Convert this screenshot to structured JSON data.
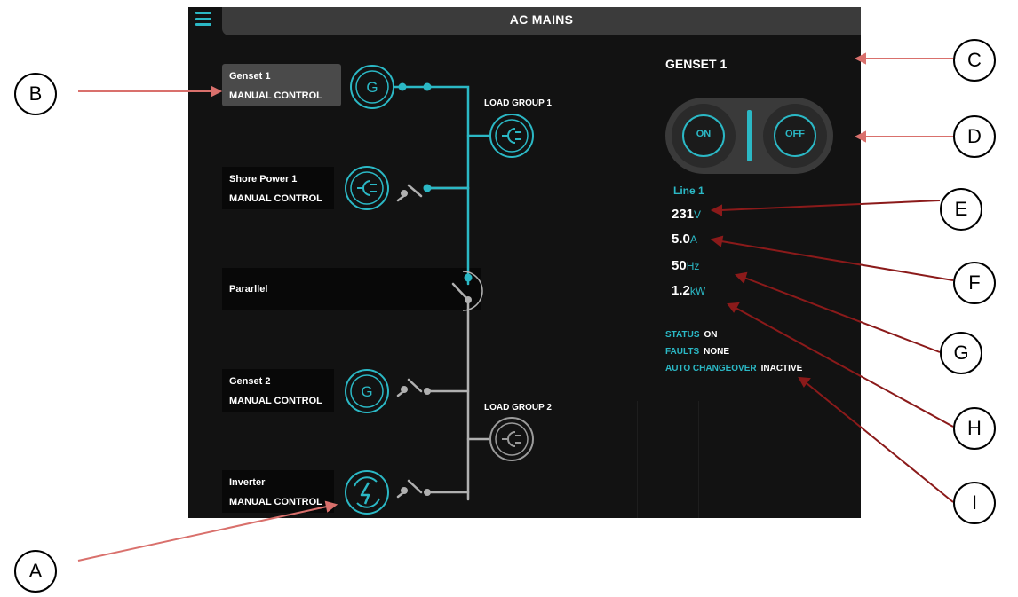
{
  "header": {
    "title": "AC MAINS",
    "menu_icon": "hamburger-menu-icon"
  },
  "sources": [
    {
      "id": "genset1",
      "name": "Genset 1",
      "mode": "MANUAL CONTROL",
      "icon": "generator-icon",
      "selected": true
    },
    {
      "id": "shore1",
      "name": "Shore Power 1",
      "mode": "MANUAL CONTROL",
      "icon": "shore-plug-icon"
    },
    {
      "id": "genset2",
      "name": "Genset 2",
      "mode": "MANUAL CONTROL",
      "icon": "generator-icon"
    },
    {
      "id": "inverter",
      "name": "Inverter",
      "mode": "MANUAL CONTROL",
      "icon": "inverter-icon"
    }
  ],
  "parallel": {
    "label": "Pararllel"
  },
  "load_groups": [
    {
      "label": "LOAD GROUP 1",
      "active": true
    },
    {
      "label": "LOAD GROUP 2",
      "active": false
    }
  ],
  "panel": {
    "title": "GENSET 1",
    "on_label": "ON",
    "off_label": "OFF",
    "line_title": "Line 1",
    "readings": [
      {
        "value": "231",
        "unit": "V"
      },
      {
        "value": "5.0",
        "unit": "A"
      },
      {
        "value": "50",
        "unit": "Hz"
      },
      {
        "value": "1.2",
        "unit": "kW"
      }
    ],
    "status_label": "STATUS",
    "status_value": "ON",
    "faults_label": "FAULTS",
    "faults_value": "NONE",
    "auto_label": "AUTO CHANGEOVER",
    "auto_value": "INACTIVE"
  },
  "callouts": [
    "A",
    "B",
    "C",
    "D",
    "E",
    "F",
    "G",
    "H",
    "I"
  ],
  "colors": {
    "accent": "#2bb8c5",
    "inactive": "#b0b0b0",
    "background": "#121212",
    "arrow": "#d9706c"
  }
}
